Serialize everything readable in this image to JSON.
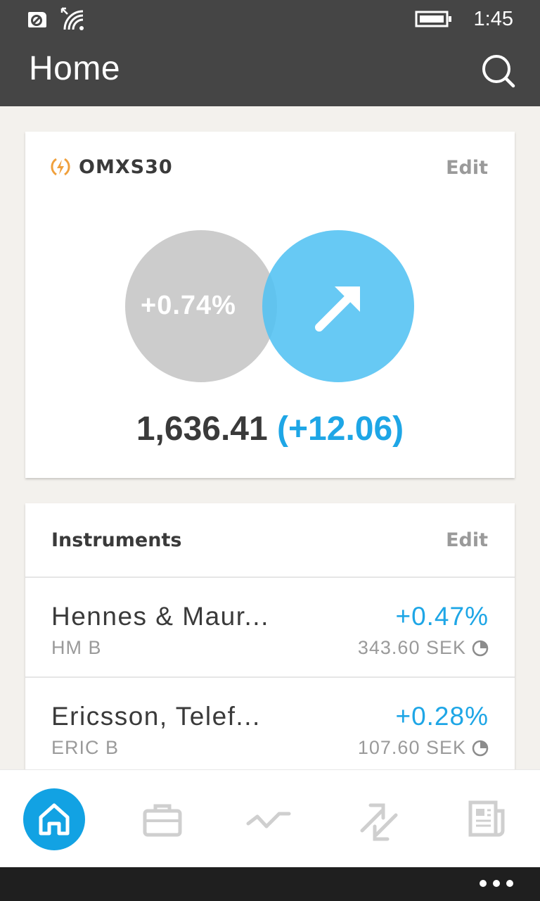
{
  "status_bar": {
    "time": "1:45",
    "icons": [
      "sync-icon",
      "wifi-icon",
      "battery-icon"
    ]
  },
  "header": {
    "title": "Home",
    "search_icon": "search-icon"
  },
  "index_card": {
    "name": "OMXS30",
    "edit_label": "Edit",
    "change_percent": "+0.74%",
    "value": "1,636.41",
    "change": "(+12.06)",
    "direction": "up",
    "accent_color": "#1ea6e6",
    "index_icon_color": "#f0a03c"
  },
  "instruments": {
    "title": "Instruments",
    "edit_label": "Edit",
    "items": [
      {
        "name": "Hennes & Maur...",
        "ticker": "HM B",
        "change": "+0.47%",
        "price": "343.60 SEK"
      },
      {
        "name": "Ericsson, Telef...",
        "ticker": "ERIC B",
        "change": "+0.28%",
        "price": "107.60 SEK"
      }
    ]
  },
  "bottom_nav": {
    "items": [
      "home-icon",
      "portfolio-icon",
      "chart-icon",
      "transfer-icon",
      "news-icon"
    ],
    "active": "home-icon",
    "active_color": "#12a2e3"
  }
}
